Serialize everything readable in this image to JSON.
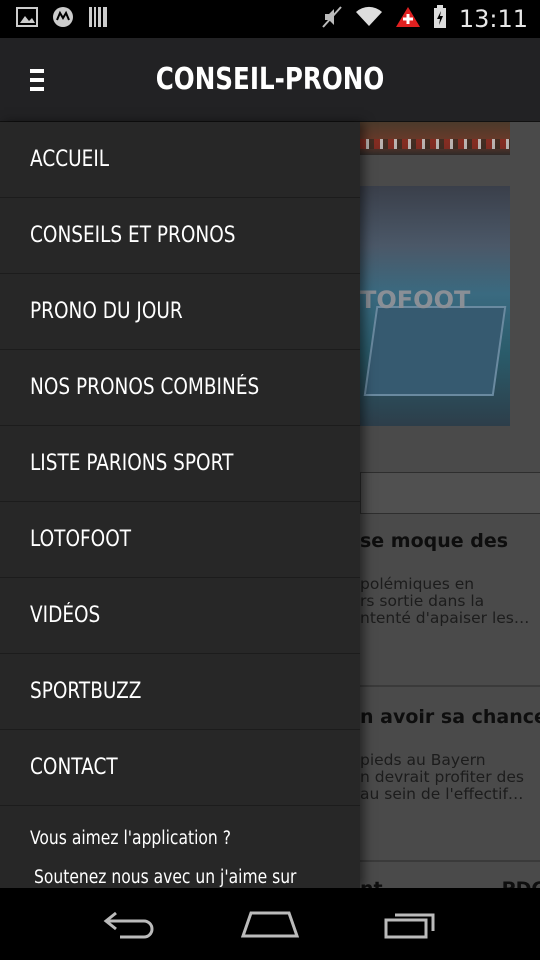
{
  "status_bar": {
    "time": "13:11",
    "left_icons": [
      "image-icon",
      "motorola-icon",
      "barcode-icon"
    ],
    "right_icons": [
      "mute-icon",
      "wifi-icon",
      "alert-icon",
      "battery-icon"
    ]
  },
  "app_bar": {
    "title": "CONSEIL-PRONO",
    "menu_icon": "hamburger-icon"
  },
  "drawer": {
    "items": [
      {
        "label": "ACCUEIL"
      },
      {
        "label": "CONSEILS ET PRONOS"
      },
      {
        "label": "PRONO DU JOUR"
      },
      {
        "label": "NOS PRONOS COMBINÉS"
      },
      {
        "label": "LISTE PARIONS SPORT"
      },
      {
        "label": "LOTOFOOT"
      },
      {
        "label": "VIDÉOS"
      },
      {
        "label": "SPORTBUZZ"
      },
      {
        "label": "CONTACT"
      }
    ],
    "promo_question": "Vous aimez l'application ?",
    "promo_sub": "Soutenez nous avec un j'aime sur"
  },
  "background": {
    "image_watermark": "TOFOOT",
    "articles": [
      {
        "title": "se moque des",
        "lines": [
          "polémiques en",
          "rs sortie dans la",
          "ntenté d'apaiser les…"
        ]
      },
      {
        "title": "n avoir sa chance",
        "lines": [
          "pieds au Bayern",
          "n devrait profiter des",
          "au sein de l'effectif…"
        ]
      },
      {
        "title": "nt                  PDG"
      }
    ]
  },
  "nav_bar": {
    "icons": [
      "back-icon",
      "home-icon",
      "recents-icon"
    ]
  },
  "colors": {
    "drawer_bg": "#272727",
    "app_bar_bg": "#222224",
    "status_bar_bg": "#000000",
    "alert_red": "#e02020"
  }
}
